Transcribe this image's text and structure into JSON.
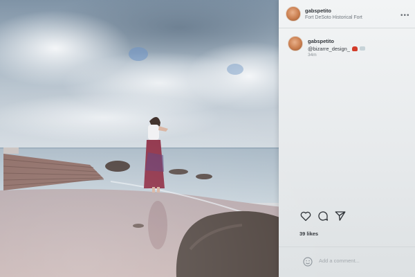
{
  "post": {
    "username": "gabspetito",
    "location": "Fort DeSoto Historical Fort",
    "more_label": "•••",
    "caption": {
      "username": "gabspetito",
      "text": "@bizarre_design_",
      "time": "34m"
    },
    "likes": "39 likes",
    "comment_placeholder": "Add a comment..."
  },
  "icons": {
    "like": "heart-icon",
    "comment": "speech-bubble-icon",
    "share": "paper-plane-icon",
    "emoji": "smiley-icon"
  },
  "colors": {
    "panel_bg": "#eef1f2",
    "text_primary": "#2f3338",
    "text_secondary": "#6f767d",
    "crab_emoji": "#d23c2a"
  }
}
